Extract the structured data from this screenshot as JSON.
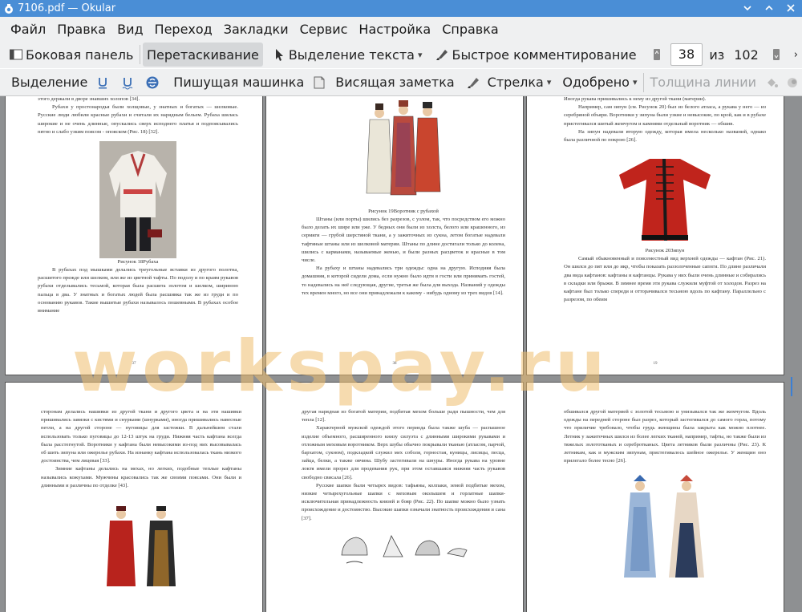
{
  "window": {
    "title": "7106.pdf — Okular"
  },
  "menu": [
    "Файл",
    "Правка",
    "Вид",
    "Переход",
    "Закладки",
    "Сервис",
    "Настройка",
    "Справка"
  ],
  "toolbar1": {
    "sidebar": "Боковая панель",
    "drag": "Перетаскивание",
    "text_select": "Выделение текста",
    "quick_comment": "Быстрое комментирование",
    "page_current": "38",
    "page_of": "из",
    "page_total": "102"
  },
  "toolbar2": {
    "select": "Выделение",
    "typewriter": "Пишущая машинка",
    "sticky_note": "Висящая заметка",
    "arrow": "Стрелка",
    "approved": "Одобрено",
    "line_width": "Толщина линии"
  },
  "watermark": "workspay.ru",
  "pages": {
    "p17": {
      "top": "этого держали в дворе знавших холопов [34].",
      "para1": "Рубахи у простонародья были холщовые, у знатных и богатых — шелковые. Русские люди любили красные рубахи и считали их нарядным бельем. Рубаха шилась широкие и не очень длинные, опускались сверх исподнего платья и подпоясывались пятно и слабо узким поясом - опояском (Рис. 18) [32].",
      "caption": "Рисунок 18Рубаха",
      "para2": "В рубахах под мышками делались треугольные вставки из другого полотна, расшитого прежде или шелком, или же из цветной тафты. По подолу и по краям рукавов рубахи отделывались тесьмой, которая была расшита золотом и шелком, шириною пальца в два. У знатных и богатых людей была расшивка так же из груди и по основанию рукавов. Такие вышитые рубахи называлось пошевными. В рубахах особое внимание",
      "num": "37"
    },
    "p18": {
      "caption": "Рисунок 19Воротник с рубахой",
      "para1": "Штаны (или порты) шились без разрезов, с узлом, так, что посредством его можно было делать их шире или уже. У бедных они были из холста, белого или крашенного, из сермяги — грубой шерстяной ткани, а у зажиточных из сукна, летом богатые надевали тафтяные штаны или из шелковой материи. Штаны по длине достигали только до колена, шились с карманами, называемые женью, и были разных расцветок и красные в том числе.",
      "para2": "На рубаху и штаны надевались три одежды: одна на другую. Исподняя была домашняя, в которой сидели дома, если нужно было идти в гости или принимать гостей, то надевались на неё следующая, другие, третья же была для выхода. Названий у одежды тех времен много, но все они принадлежали к какому - нибудь одному из трех видов [14].",
      "num": "38"
    },
    "p19": {
      "top": "Иногда рукава пришивались к нему из другой ткани (материи).",
      "para1": "Например, сам зипун (см. Рисунок 20) был из белого атласа, а рукава у него — из серебряной объяри. Воротники у зипуна были узкие и невысокие, по крой, как и в рубахе пристегивался шитый жемчугом и камнями отдельный воротник — обшив.",
      "para2": "На зипун надевали вторую одежду, которая имела несколько названий, однако была различной по покрою [26].",
      "caption": "Рисунок 20Зипун",
      "para3": "Самый обыкновенный и повсеместный вид верхней одежды — кафтан (Рис. 21). Он шился до пят или до икр, чтобы показать раззолоченные сапоги. По длине различали два вида кафтанов: кафтаны и кафтанцы. Рукава у них были очень длинные и собирались в складки или брыжи. В зимнее время эти рукава служили муфтой от холодов. Разрез на кафтане был только спереди и отторачивался тесьмою вдоль по кафтану. Параллельно с разрезом, по обеим",
      "num": "19"
    },
    "p20": {
      "para1": "сторонам делались нашивки из другой ткани и другого цвета и на эти нашивки пришивались завязки с кистями и снурками (шнурками), иногда пришивались навесные петли, а на другой стороне — пуговицы для застежки. В дальнейшем стали использовать только пуговицы до 12-13 штук на груди. Нижняя часть кафтана всегда была расстегнутой. Воротники у кафтана были невысокими из-под них высовывалась об шить зипуна или ожерелье рубахи. На изнанку кафтана использовалась ткань низкого достоинства, чем лицевая [33].",
      "para2": "Зимние кафтаны делались на мехах, но легких, подобные теплые кафтаны назывались кожухами. Мужчины красовались так же своими поясами. Они были и длинными и различны по отделке [43]."
    },
    "p21": {
      "para1": "другая нарядная из богатой материи, подбитая мехом больше ради пышности, чем для тепла [12].",
      "para2": "Характерной мужской одеждой этого периода была также шуба — распашное изделие объемного, расширенного книзу силуэта с длинными широкими рукавами и отложным меховым воротником. Верх шубы обычно покрывали тканью (атласом, парчой, бархатом, сукном), подкладкой служил мех соболя, горностая, куницы, лисицы, песца, зайца, белки, а также овчина. Шубу застегивали на шнуры. Иногда рукава на уровне локтя имели прорез для продевания рук, при этом оставшаяся нижняя часть рукавов свободно свисала [26].",
      "para3": "Русские шапки были четырех видов: тафьяны, колпаки, земой подбитые мехом, низкие четырехугольные шапки с меховым околышем и горлатные шапки- исключительная принадлежность князей и бояр (Рис. 22). По шапке можно было узнать происхождение и достоинство. Высокие шапки означали знатность происхождения и сана [37]."
    },
    "p22": {
      "para1": "обшивался другой материей с золотой тесьмою и унизывался так же жемчугом. Вдоль одежды на передней стороне был разрез, который застегивался до самого горла, потому что приличие требовало, чтобы грудь женщины была закрыта как можно плотнее. Летник у зажиточных шился из более легких тканей, например, тафты, но также были из тяжелых золототканых и серебротканых. Цвета летников были различны (Рис. 23). К летникам, как и мужским зипунам, пристегивалось шейное ожерелье. У женщин оно прилегало более тесно [26]."
    }
  }
}
